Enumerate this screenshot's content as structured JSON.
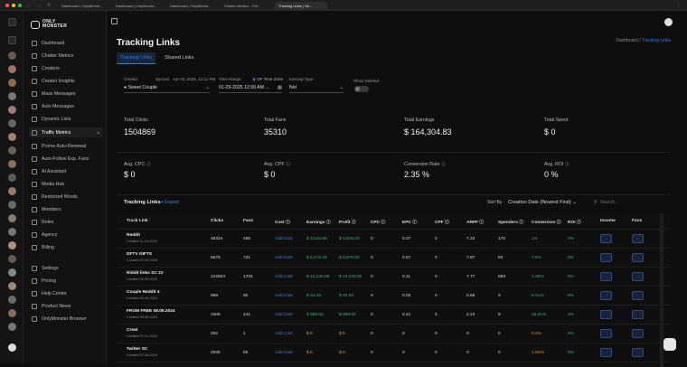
{
  "browser": {
    "tabs": [
      {
        "label": "Dashboard | OnlyMonst..."
      },
      {
        "label": "Dashboard | OnlyMonst..."
      },
      {
        "label": "Dashboard | OnlyMonst..."
      },
      {
        "label": "Chatter Metrics - Onl..."
      },
      {
        "label": "Tracking Links | On..."
      }
    ]
  },
  "sidebar": {
    "logo_line1": "ONLY",
    "logo_line2": "MONSTER",
    "items": [
      {
        "label": "Dashboard"
      },
      {
        "label": "Chatter Metrics"
      },
      {
        "label": "Creators"
      },
      {
        "label": "Creator Insights"
      },
      {
        "label": "Mass Messages"
      },
      {
        "label": "Auto Messages"
      },
      {
        "label": "Dynamic Lists"
      },
      {
        "label": "Traffic Metrics",
        "chev": "▴"
      },
      {
        "label": "Promo Auto-Renewal"
      },
      {
        "label": "Auto-Follow Exp. Fans"
      },
      {
        "label": "AI Assistant"
      },
      {
        "label": "Media Hub"
      },
      {
        "label": "Restricted Words"
      },
      {
        "label": "Members"
      },
      {
        "label": "Roles"
      },
      {
        "label": "Agency"
      },
      {
        "label": "Billing"
      },
      {
        "label": "Settings"
      },
      {
        "label": "Pricing"
      },
      {
        "label": "Help Center"
      },
      {
        "label": "Product News"
      },
      {
        "label": "OnlyMonster Browser"
      }
    ]
  },
  "page": {
    "title": "Tracking Links",
    "breadcrumb_root": "Dashboard",
    "breadcrumb_sep": "/",
    "breadcrumb_current": "Tracking Links",
    "tabs": [
      "Tracking Links",
      "Shared Links"
    ]
  },
  "filters": {
    "creator_label": "Creator:",
    "creator_value": "Sweet Couple",
    "synced_label": "Synced",
    "synced_value": "Apr 03, 2025, 12:11 PM",
    "time_range_label": "Time Range:",
    "time_range_value": "01-29-2025 12:00 AM →",
    "tz_label": "OF Time Zone",
    "earning_type_label": "Earning Type:",
    "earning_type_value": "Net",
    "show_deleted_label": "Show Deleted"
  },
  "stats": [
    {
      "label": "Total Clicks",
      "value": "1504869"
    },
    {
      "label": "Total Fans",
      "value": "35310"
    },
    {
      "label": "Total Earnings",
      "value": "$ 164,304.83"
    },
    {
      "label": "Total Spent",
      "value": "$ 0"
    },
    {
      "label": "Avg. CPC",
      "value": "$ 0"
    },
    {
      "label": "Avg. CPF",
      "value": "$ 0"
    },
    {
      "label": "Conversion Rate",
      "value": "2.35 %"
    },
    {
      "label": "Avg. ROI",
      "value": "0 %"
    }
  ],
  "table": {
    "section_title": "Tracking Links",
    "export_label": "Export",
    "sort_label": "Sort By",
    "sort_value": "Creation Date (Newest First)",
    "search_placeholder": "Search...",
    "columns": [
      "Track Link",
      "Clicks",
      "Fans",
      "Cost",
      "Earnings",
      "Profit",
      "CPC",
      "EPC",
      "CPF",
      "ARPF",
      "Spenders",
      "Conversion",
      "ROI",
      "Income",
      "Fans"
    ],
    "rows": [
      {
        "name": "Reddit",
        "created": "Created 11-13-2024",
        "clicks": "49324",
        "fans": "495",
        "cost": "Add Cost",
        "earnings": "$ 3,526.66",
        "profit": "$ 3,526.20",
        "cpc": "0",
        "epc": "0.07",
        "cpf": "0",
        "arpf": "7.23",
        "spenders": "170",
        "conversion": "1%",
        "roi": "0%"
      },
      {
        "name": "DFTV GIFTS",
        "created": "Created 07-09-2024",
        "clicks": "5676",
        "fans": "721",
        "cost": "Add Cost",
        "earnings": "$ 5,675.44",
        "profit": "$ 5,675.00",
        "cpc": "0",
        "epc": "0.57",
        "cpf": "0",
        "arpf": "7.87",
        "spenders": "93",
        "conversion": "7.5%",
        "roi": "0%"
      },
      {
        "name": "Riddit links SC 22",
        "created": "Created 06-09-2024",
        "clicks": "122923",
        "fans": "1704",
        "cost": "Add Cost",
        "earnings": "$ 13,230.88",
        "profit": "$ 13,230.00",
        "cpc": "0",
        "epc": "0.11",
        "cpf": "0",
        "arpf": "7.77",
        "spenders": "583",
        "conversion": "1.39%",
        "roi": "0%"
      },
      {
        "name": "Couple Reddit 4",
        "created": "Created 06-05-2024",
        "clicks": "996",
        "fans": "50",
        "cost": "Add Cost",
        "earnings": "$ 34.45",
        "profit": "$ 30.00",
        "cpc": "0",
        "epc": "0.03",
        "cpf": "0",
        "arpf": "0.69",
        "spenders": "3",
        "conversion": "5.01%",
        "roi": "0%"
      },
      {
        "name": "FROM FREE 08.05.2024",
        "created": "Created 05-08-2024",
        "clicks": "2408",
        "fans": "441",
        "cost": "Add Cost",
        "earnings": "$ 988.53",
        "profit": "$ 988.00",
        "cpc": "0",
        "epc": "0.41",
        "cpf": "0",
        "arpf": "2.24",
        "spenders": "9",
        "conversion": "18.31%",
        "roi": "0%"
      },
      {
        "name": "Creat",
        "created": "Created 07-01-2024",
        "clicks": "252",
        "fans": "1",
        "cost": "Add Cost",
        "earnings": "$ 0",
        "profit": "$ 0",
        "cpc": "0",
        "epc": "0",
        "cpf": "0",
        "arpf": "0",
        "spenders": "0",
        "conversion": "0.4%",
        "roi": "0%"
      },
      {
        "name": "Twitter SC",
        "created": "Created 07-28-2024",
        "clicks": "2935",
        "fans": "56",
        "cost": "Add Cost",
        "earnings": "$ 0",
        "profit": "$ 0",
        "cpc": "0",
        "epc": "0",
        "cpf": "0",
        "arpf": "0",
        "spenders": "0",
        "conversion": "1.91%",
        "roi": "0%"
      }
    ]
  }
}
